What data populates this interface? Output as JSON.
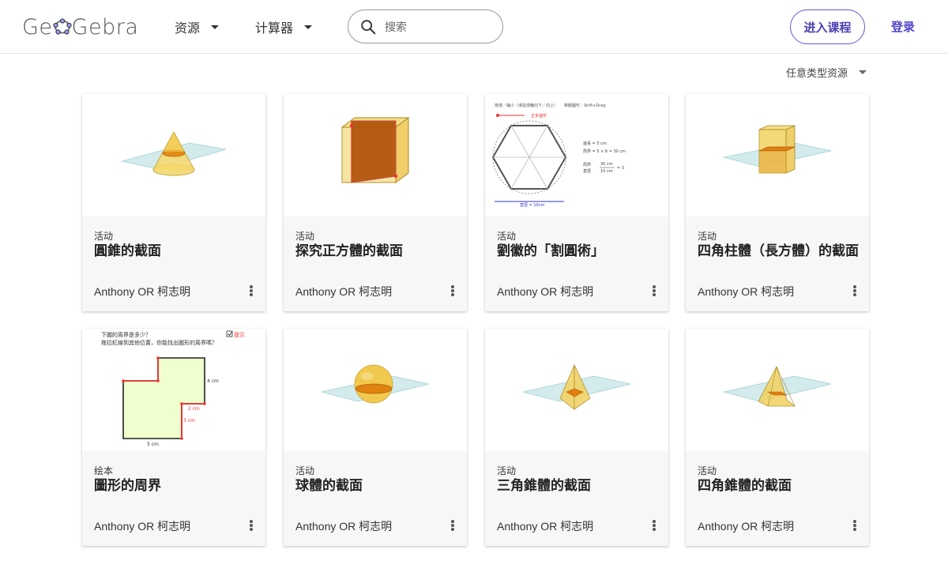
{
  "header": {
    "logo_text": "GeoGebra",
    "nav": {
      "resources_label": "资源",
      "calculators_label": "计算器"
    },
    "search": {
      "placeholder": "搜索"
    },
    "enter_class_label": "进入课程",
    "login_label": "登录"
  },
  "filter": {
    "label": "任意类型资源"
  },
  "cards": [
    {
      "type": "活动",
      "title": "圓錐的截面",
      "author": "Anthony OR 柯志明",
      "thumbnail": "cone-section"
    },
    {
      "type": "活动",
      "title": "探究正方體的截面",
      "author": "Anthony OR 柯志明",
      "thumbnail": "cube-section"
    },
    {
      "type": "活动",
      "title": "劉徽的「割圓術」",
      "author": "Anthony OR 柯志明",
      "thumbnail": "hexagon-circle",
      "thumb_text": {
        "top_left": "拖曳／縮小（滑鼠滾輪向下／向上）",
        "top_right": "移動圖形：Shift+Drag",
        "red_label": "正多邊形",
        "side_length": "邊長 = 5 cm",
        "perimeter": "周界 = 5 × 6 = 30 cm",
        "ratio_label_top": "周界",
        "ratio_label_bottom": "直徑",
        "ratio_num": "30 cm",
        "ratio_den": "10 cm",
        "ratio_result": "= 3",
        "diameter": "直徑 = 10cm"
      }
    },
    {
      "type": "活动",
      "title": "四角柱體（長方體）的截面",
      "author": "Anthony OR 柯志明",
      "thumbnail": "prism-section"
    },
    {
      "type": "绘本",
      "title": "圖形的周界",
      "author": "Anthony OR 柯志明",
      "thumbnail": "perimeter-shape",
      "thumb_text": {
        "question": "下圖的周界是多少？",
        "instruction": "拖拉紅線到其他位置，你能找出圖形的周界嗎？",
        "checkbox_label": "提示",
        "dim_4": "4 cm",
        "dim_2": "2 cm",
        "dim_3": "3 cm",
        "dim_5": "5 cm"
      }
    },
    {
      "type": "活动",
      "title": "球體的截面",
      "author": "Anthony OR 柯志明",
      "thumbnail": "sphere-section"
    },
    {
      "type": "活动",
      "title": "三角錐體的截面",
      "author": "Anthony OR 柯志明",
      "thumbnail": "triangular-pyramid-section"
    },
    {
      "type": "活动",
      "title": "四角錐體的截面",
      "author": "Anthony OR 柯志明",
      "thumbnail": "square-pyramid-section"
    }
  ]
}
